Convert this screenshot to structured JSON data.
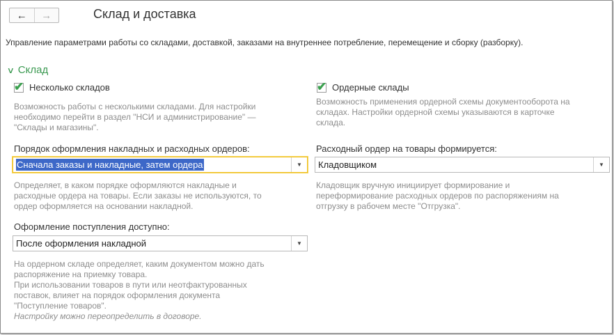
{
  "nav": {
    "back_icon": "←",
    "forward_icon": "→"
  },
  "header": {
    "title": "Склад и доставка"
  },
  "description": "Управление параметрами работы со складами, доставкой, заказами на внутреннее потребление, перемещение и сборку (разборку).",
  "section": {
    "title": "Склад",
    "chevron": "∨"
  },
  "left": {
    "multiple_warehouses": {
      "label": "Несколько складов",
      "checked": true,
      "hint": [
        "Возможность работы с несколькими складами. Для настройки",
        "необходимо перейти в раздел \"НСИ и администрирование\" —",
        "\"Склады и магазины\"."
      ]
    },
    "order_procedure": {
      "label": "Порядок оформления накладных и расходных ордеров:",
      "value": "Сначала заказы и накладные, затем ордера",
      "hint": [
        "Определяет, в каком порядке оформляются накладные и",
        "расходные ордера на товары. Если заказы не используются, то",
        "ордер оформляется на основании накладной."
      ]
    },
    "receipt": {
      "label": "Оформление поступления доступно:",
      "value": "После оформления накладной",
      "hint": [
        "На ордерном складе определяет, каким документом можно дать",
        "распоряжение на приемку товара.",
        "При использовании товаров в пути или неотфактурованных",
        "поставок, влияет на порядок оформления документа",
        "\"Поступление товаров\"."
      ],
      "hint_italic": "Настройку можно переопределить в договоре."
    }
  },
  "right": {
    "order_warehouses": {
      "label": "Ордерные склады",
      "checked": true,
      "hint": [
        "Возможность применения ордерной схемы документооборота на",
        "складах. Настройки ордерной схемы указываются в карточке",
        "склада."
      ]
    },
    "expense_order": {
      "label": "Расходный ордер на товары формируется:",
      "value": "Кладовщиком",
      "hint": [
        "Кладовщик вручную инициирует формирование и",
        "переформирование расходных ордеров по распоряжениям на",
        "отгрузку в рабочем месте \"Отгрузка\"."
      ]
    }
  },
  "icons": {
    "checkbox_tick": "✔",
    "dropdown_arrow": "▼"
  }
}
